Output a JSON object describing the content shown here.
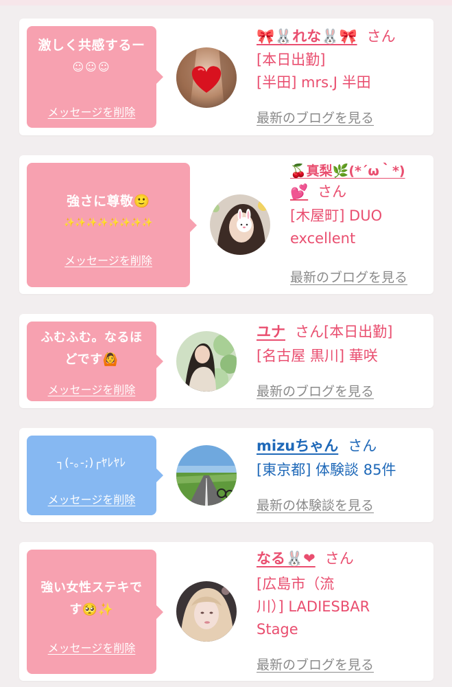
{
  "accent": "#e94e6f",
  "pink_bubble": "#f7a1b0",
  "blue_bubble": "#86b8f2",
  "items": [
    {
      "bubble_line1": "激しく共感するー",
      "bubble_line2": "☺☺☺",
      "delete_label": "メッセージを削除",
      "name": "🎀🐰れな🐰🎀",
      "san": "さん",
      "status": "[本日出勤]",
      "shop": "[半田] mrs.J 半田",
      "blog_label": "最新のブログを見る",
      "avatar_icon": "heart-sticker-portrait"
    },
    {
      "bubble_line1": "強さに尊敬🙂",
      "bubble_line2": "✨✨✨✨✨✨✨✨",
      "delete_label": "メッセージを削除",
      "name": "🍒真梨🌿(*´ω｀*)",
      "name_line2": "💕",
      "san": "さん",
      "shop": "[木屋町] DUO",
      "shop_line2": "excellent",
      "blog_label": "最新のブログを見る",
      "avatar_icon": "bunny-sticker-portrait"
    },
    {
      "bubble_line1": "ふむふむ。なるほ",
      "bubble_line2": "どです🙆",
      "delete_label": "メッセージを削除",
      "name": "ユナ",
      "san": "さん[本日出勤]",
      "shop": "[名古屋 黒川] 華咲",
      "blog_label": "最新のブログを見る",
      "avatar_icon": "garden-portrait"
    },
    {
      "bubble_line1": "┐(-｡-;)┌ﾔﾚﾔﾚ",
      "delete_label": "メッセージを削除",
      "name": "mizuちゃん",
      "san": "さん",
      "shop": "[東京都] 体験談 85件",
      "blog_label": "最新の体験談を見る",
      "avatar_icon": "road-landscape"
    },
    {
      "bubble_line1": "強い女性ステキで",
      "bubble_line2": "す🥺✨",
      "delete_label": "メッセージを削除",
      "name": "なる🐰❤",
      "san": "さん",
      "shop": "[広島市（流",
      "shop_line2": "川）] LADIESBAR",
      "shop_line3": "Stage",
      "blog_label": "最新のブログを見る",
      "avatar_icon": "blonde-portrait"
    }
  ]
}
